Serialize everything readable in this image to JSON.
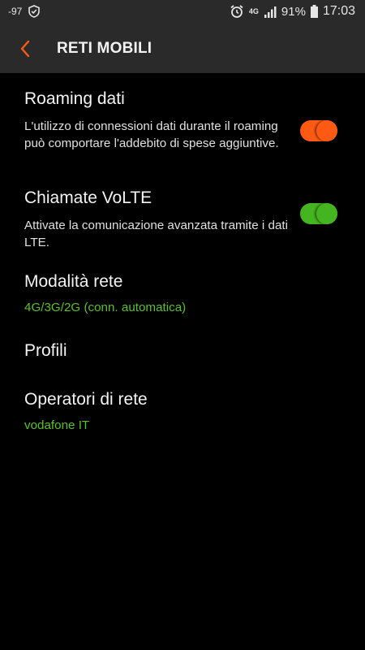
{
  "status_bar": {
    "signal_strength": "-97",
    "network_type": "4G",
    "battery_percent": "91%",
    "time": "17:03",
    "icons": [
      "shield-check-icon",
      "alarm-clock-icon",
      "lte-icon",
      "cell-signal-icon",
      "battery-icon"
    ]
  },
  "app_bar": {
    "title": "RETI MOBILI",
    "back_icon": "chevron-left-icon"
  },
  "settings": {
    "roaming": {
      "title": "Roaming dati",
      "description": "L'utilizzo di connessioni dati durante il roaming può comportare l'addebito di spese aggiuntive.",
      "enabled": true
    },
    "volte": {
      "title": "Chiamate VoLTE",
      "description": "Attivate la comunicazione avanzata tramite i dati LTE.",
      "enabled": true
    },
    "network_mode": {
      "title": "Modalità rete",
      "summary": "4G/3G/2G (conn. automatica)"
    },
    "profiles": {
      "title": "Profili"
    },
    "operators": {
      "title": "Operatori di rete",
      "summary": "vodafone IT"
    }
  },
  "colors": {
    "accent_orange": "#ff5a14",
    "accent_green": "#45b421",
    "summary_green": "#5cc02e",
    "background": "#000000",
    "bar": "#2a2a2a"
  }
}
